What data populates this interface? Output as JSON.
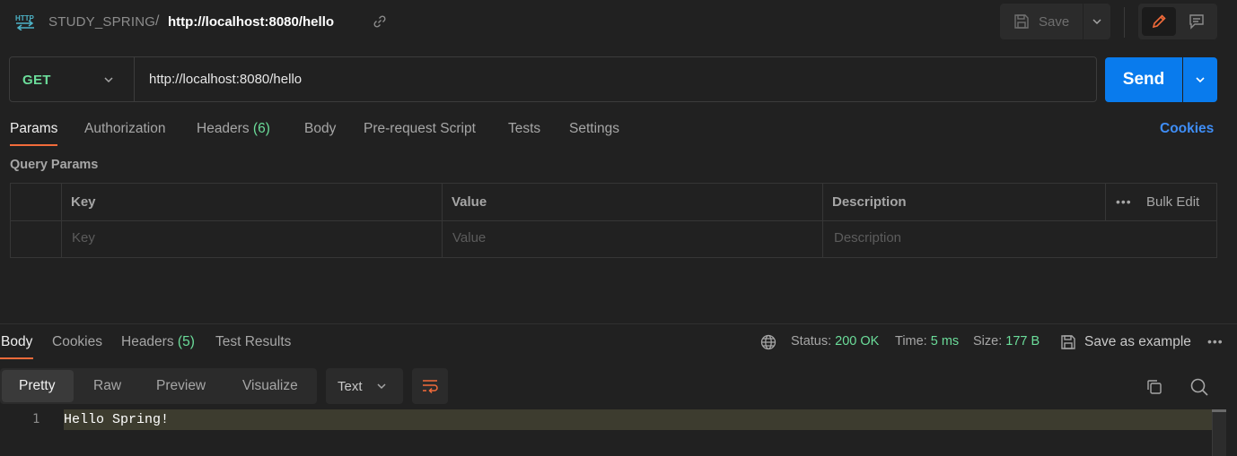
{
  "header": {
    "collection": "STUDY_SPRING",
    "separator": "/",
    "request_name": "http://localhost:8080/hello",
    "save_label": "Save"
  },
  "request": {
    "method": "GET",
    "url": "http://localhost:8080/hello",
    "send_label": "Send"
  },
  "request_tabs": {
    "params": "Params",
    "authorization": "Authorization",
    "headers": "Headers",
    "headers_count": "(6)",
    "body": "Body",
    "pre_request": "Pre-request Script",
    "tests": "Tests",
    "settings": "Settings",
    "cookies": "Cookies"
  },
  "query_params": {
    "title": "Query Params",
    "columns": [
      "Key",
      "Value",
      "Description"
    ],
    "bulk_edit": "Bulk Edit",
    "placeholders": [
      "Key",
      "Value",
      "Description"
    ]
  },
  "response": {
    "tabs": {
      "body": "Body",
      "cookies": "Cookies",
      "headers": "Headers",
      "headers_count": "(5)",
      "test_results": "Test Results"
    },
    "status_label": "Status:",
    "status_value": "200 OK",
    "time_label": "Time:",
    "time_value": "5 ms",
    "size_label": "Size:",
    "size_value": "177 B",
    "save_example": "Save as example",
    "views": [
      "Pretty",
      "Raw",
      "Preview",
      "Visualize"
    ],
    "format": "Text",
    "lines": [
      {
        "no": "1",
        "text": "Hello Spring!"
      }
    ]
  },
  "colors": {
    "accent_orange": "#f26b3a",
    "send_blue": "#097bed",
    "method_green": "#6bdd9a",
    "link_blue": "#3f8ef7"
  },
  "icons": [
    "http-icon",
    "link-icon",
    "save-icon",
    "chevron-down-icon",
    "pencil-icon",
    "comment-icon",
    "globe-icon",
    "more-icon",
    "wrap-icon",
    "copy-icon",
    "search-icon"
  ]
}
